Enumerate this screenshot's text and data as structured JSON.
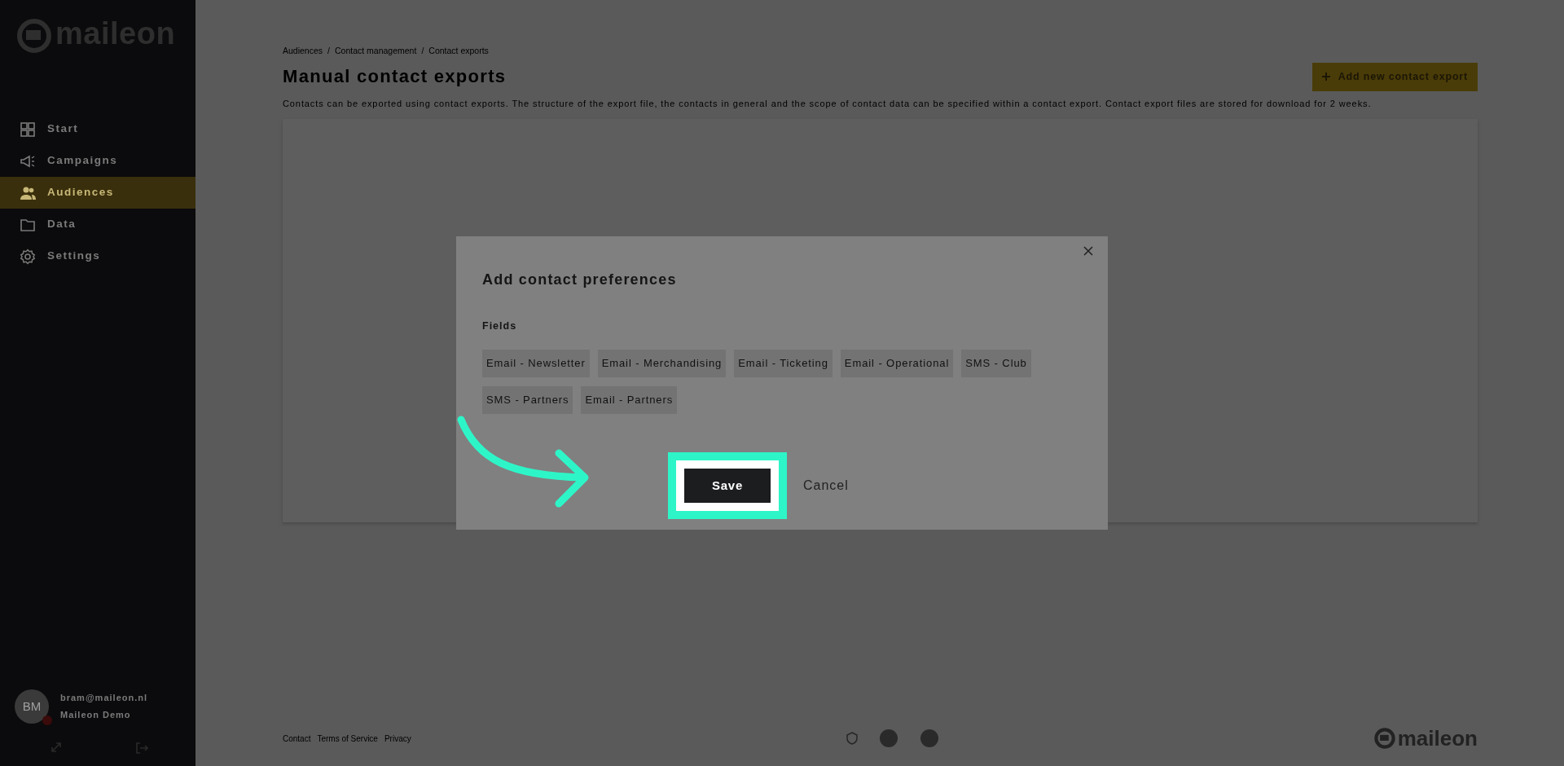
{
  "sidebar": {
    "logo": "maileon",
    "items": [
      {
        "label": "Start",
        "selected": false
      },
      {
        "label": "Campaigns",
        "selected": false
      },
      {
        "label": "Audiences",
        "selected": true
      },
      {
        "label": "Data",
        "selected": false
      },
      {
        "label": "Settings",
        "selected": false
      }
    ],
    "user": {
      "initials": "BM",
      "email": "bram@maileon.nl",
      "name": "Maileon Demo"
    }
  },
  "breadcrumb": [
    "Audiences",
    "Contact management",
    "Contact exports"
  ],
  "breadcrumb_separator": "/",
  "page": {
    "title": "Manual contact exports",
    "add_button": "Add new contact export",
    "description": "Contacts can be exported using contact exports. The structure of the export file, the contacts in general and the scope of contact data can be specified within a contact export. Contact export files are stored for download for 2 weeks."
  },
  "footer": {
    "links": [
      "Contact",
      "Terms of Service",
      "Privacy"
    ],
    "logo": "maileon"
  },
  "modal": {
    "title": "Add contact preferences",
    "fields_label": "Fields",
    "fields": [
      "Email - Newsletter",
      "Email - Merchandising",
      "Email - Ticketing",
      "Email - Operational",
      "SMS - Club",
      "SMS - Partners",
      "Email - Partners"
    ],
    "save": "Save",
    "save_highlighted": true,
    "cancel": "Cancel"
  }
}
